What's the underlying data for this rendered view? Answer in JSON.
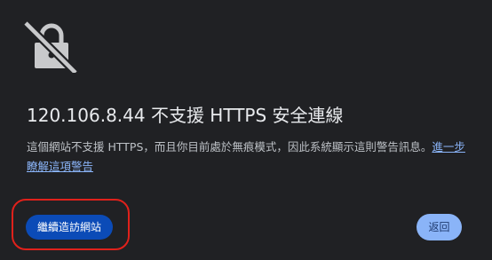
{
  "interstitial": {
    "icon": "lock-crossed-out-icon",
    "title": "120.106.8.44 不支援 HTTPS 安全連線",
    "description": "這個網站不支援 HTTPS，而且你目前處於無痕模式，因此系統顯示這則警告訊息。",
    "learn_more_link": "進一步瞭解這項警告",
    "continue_button": "繼續造訪網站",
    "back_button": "返回"
  },
  "colors": {
    "background": "#202124",
    "title_text": "#e8eaed",
    "body_text": "#bdc1c6",
    "link": "#8ab4f8",
    "continue_button_bg": "#0b4bb7",
    "back_button_bg": "#8ab4f8",
    "annotation_outline": "#e0211b"
  }
}
